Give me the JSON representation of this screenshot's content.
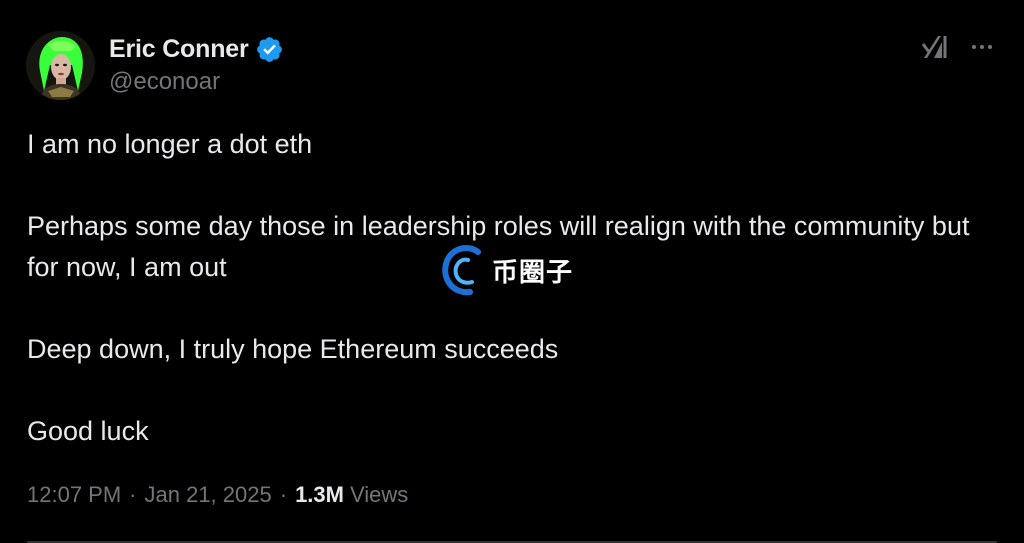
{
  "author": {
    "display_name": "Eric Conner",
    "handle": "@econoar",
    "verified": true,
    "verified_color": "#1d9bf0",
    "avatar_icon": "profile-avatar"
  },
  "header_actions": {
    "grok_icon": "grok-icon",
    "more_icon": "more-options-icon"
  },
  "tweet": {
    "paragraphs": [
      "I am no longer a dot eth",
      "Perhaps some day those in leadership roles will realign with the community but for now, I am out",
      "Deep down, I truly hope Ethereum succeeds",
      "Good luck"
    ]
  },
  "watermark": {
    "text": "币圈子"
  },
  "meta": {
    "time": "12:07 PM",
    "separator": "·",
    "date": "Jan 21, 2025",
    "views_count": "1.3M",
    "views_label": "Views"
  }
}
